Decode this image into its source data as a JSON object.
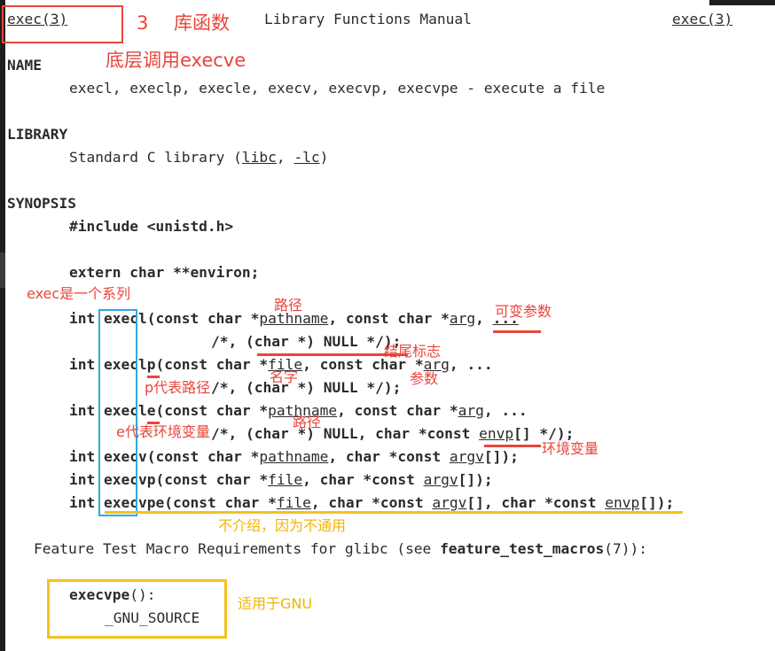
{
  "header": {
    "left": "exec(3)",
    "center": "Library Functions Manual",
    "right": "exec(3)"
  },
  "sections": {
    "name_heading": "NAME",
    "name_text": "execl, execlp, execle, execv, execvp, execvpe - execute a file",
    "library_heading": "LIBRARY",
    "library_prefix": "Standard C library (",
    "library_libc": "libc",
    "library_sep": ", ",
    "library_lc": "-lc",
    "library_suffix": ")",
    "synopsis_heading": "SYNOPSIS",
    "include": "#include <unistd.h>",
    "extern": "extern char **environ;"
  },
  "synopsis": {
    "execl": {
      "ret": "int ",
      "fn": "execl",
      "p1": "(const char *",
      "a1": "pathname",
      "p2": ", const char *",
      "a2": "arg",
      "p3": ", ",
      "dots": "..."
    },
    "execl_cont": "/*, (char *) NULL */);",
    "execlp": {
      "ret": "int ",
      "fn": "execlp",
      "p1": "(const char *",
      "a1": "file",
      "p2": ", const char *",
      "a2": "arg",
      "p3": ", ..."
    },
    "execlp_cont": "/*, (char *) NULL */);",
    "execle": {
      "ret": "int ",
      "fn": "execle",
      "p1": "(const char *",
      "a1": "pathname",
      "p2": ", const char *",
      "a2": "arg",
      "p3": ", ..."
    },
    "execle_cont": {
      "p1": "/*, (char *) NULL, char *const ",
      "a1": "envp",
      "p2": "[] */);"
    },
    "execv": {
      "ret": "int ",
      "fn": "execv",
      "p1": "(const char *",
      "a1": "pathname",
      "p2": ", char *const ",
      "a2": "argv",
      "p3": "[]);"
    },
    "execvp": {
      "ret": "int ",
      "fn": "execvp",
      "p1": "(const char *",
      "a1": "file",
      "p2": ", char *const ",
      "a2": "argv",
      "p3": "[]);"
    },
    "execvpe": {
      "ret": "int ",
      "fn": "execvpe",
      "p1": "(const char *",
      "a1": "file",
      "p2": ", char *const ",
      "a2": "argv",
      "p3": "[], char *const ",
      "a3": "envp",
      "p4": "[]);"
    }
  },
  "feature_test": {
    "prefix": "Feature Test Macro Requirements for glibc (see ",
    "link": "feature_test_macros",
    "suffix": "(7)):",
    "func": "execvpe",
    "func_suffix": "():",
    "macro": "_GNU_SOURCE"
  },
  "annotations": {
    "number": "3",
    "lib_func": "库函数",
    "uses_execve": "底层调用execve",
    "series": "exec是一个系列",
    "path": "路径",
    "variadic": "可变参数",
    "end_marker": "结尾标志",
    "p_meaning": "p代表路径",
    "name": "名字",
    "params": "参数",
    "e_meaning": "e代表环境变量",
    "path2": "路径",
    "env_var": "环境变量",
    "not_general": "不介绍，因为不通用",
    "for_gnu": "适用于GNU"
  },
  "colors": {
    "annotation_red": "#e8453c",
    "annotation_blue": "#2ea8e5",
    "annotation_yellow": "#f2c21f",
    "text": "#2b2b2b"
  }
}
